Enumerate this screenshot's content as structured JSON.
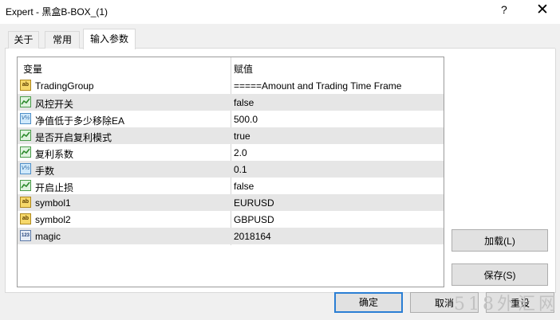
{
  "window": {
    "title": "Expert - 黑盒B-BOX_(1)",
    "help_label": "?",
    "close_label": "✕"
  },
  "tabs": [
    {
      "label": "关于",
      "active": false
    },
    {
      "label": "常用",
      "active": false
    },
    {
      "label": "输入参数",
      "active": true
    }
  ],
  "grid": {
    "headers": {
      "variable": "变量",
      "value": "赋值"
    },
    "rows": [
      {
        "icon": "string-icon",
        "name": "TradingGroup",
        "value": "=====Amount and Trading Time Frame"
      },
      {
        "icon": "bool-icon",
        "name": "风控开关",
        "value": "false"
      },
      {
        "icon": "double-icon",
        "name": "净值低于多少移除EA",
        "value": "500.0"
      },
      {
        "icon": "bool-icon",
        "name": "是否开启复利模式",
        "value": "true"
      },
      {
        "icon": "bool-icon",
        "name": "复利系数",
        "value": "2.0"
      },
      {
        "icon": "double-icon",
        "name": "手数",
        "value": "0.1"
      },
      {
        "icon": "bool-icon",
        "name": "开启止损",
        "value": "false"
      },
      {
        "icon": "string-icon",
        "name": "symbol1",
        "value": "EURUSD"
      },
      {
        "icon": "string-icon",
        "name": "symbol2",
        "value": "GBPUSD"
      },
      {
        "icon": "int-icon",
        "name": "magic",
        "value": "2018164"
      }
    ]
  },
  "icon_glyphs": {
    "string": "ab",
    "double": "V½",
    "int": "123"
  },
  "buttons": {
    "load": "加载(L)",
    "save": "保存(S)",
    "ok": "确定",
    "cancel": "取消",
    "reset": "重设"
  },
  "watermark": "518外汇网",
  "colors": {
    "accent_border": "#2a7ed4",
    "row_shade": "#e6e6e6",
    "bool_icon_green": "#2e8b2e"
  }
}
